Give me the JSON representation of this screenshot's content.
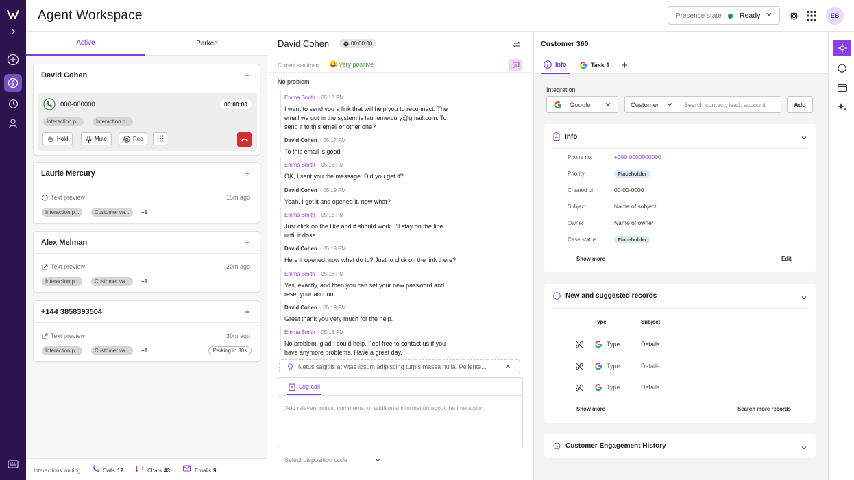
{
  "app": {
    "title": "Agent Workspace"
  },
  "header": {
    "presence_label": "Presence state",
    "presence_value": "Ready",
    "presence_color": "#1f8f3b",
    "avatar_initials": "ES"
  },
  "left_panel": {
    "tabs": [
      "Active",
      "Parked"
    ],
    "active_card": {
      "name": "David Cohen",
      "number": "000-000000",
      "timer": "00:00:00",
      "chips": [
        "Interaction p...",
        "Interaction p..."
      ],
      "buttons": {
        "hold": "Hold",
        "mute": "Mute",
        "rec": "Rec"
      }
    },
    "cards": [
      {
        "name": "Laurie Mercury",
        "preview": "Text preview",
        "age": "15m ago",
        "chips": [
          "Interaction p...",
          "Customer va..."
        ],
        "more": "+1",
        "channel": "whatsapp"
      },
      {
        "name": "Alex Melman",
        "preview": "Text preview",
        "age": "20m ago",
        "chips": [
          "Interaction p...",
          "Customer va..."
        ],
        "more": "+1",
        "channel": "external"
      },
      {
        "name": "+144 3858393504",
        "preview": "Text preview",
        "age": "30m ago",
        "chips": [
          "Interaction p...",
          "Customer va..."
        ],
        "more": "+1",
        "parking": "Parking in 30s",
        "channel": "external"
      }
    ],
    "footer": {
      "waiting_label": "Interactions waiting",
      "calls_label": "Calls",
      "calls_count": "12",
      "chats_label": "Chats",
      "chats_count": "43",
      "emails_label": "Emails",
      "emails_count": "9"
    }
  },
  "conversation": {
    "name": "David Cohen",
    "timer": "00:00:00",
    "sentiment_label": "Current sentiment",
    "sentiment_value": "Very positive",
    "first_line": "No problem",
    "messages": [
      {
        "who": "Emma Smith",
        "time": "05:18 PM",
        "agent": true,
        "lines": [
          "I want to send you a link that will help you to reconnect. The",
          "email we got in the system is lauriemercury@gmail.com. To",
          "send it to this email or other one?"
        ]
      },
      {
        "who": "David Cohen",
        "time": "05:17 PM",
        "agent": false,
        "lines": [
          "To this email is good"
        ]
      },
      {
        "who": "Emma Smith",
        "time": "05:18 PM",
        "agent": true,
        "lines": [
          "OK, I sent you the message. Did you get it?"
        ]
      },
      {
        "who": "David Cohen",
        "time": "05:19 PM",
        "agent": false,
        "lines": [
          "Yeah, I got it and opened it, now what?"
        ]
      },
      {
        "who": "Emma Smith",
        "time": "05:18 PM",
        "agent": true,
        "lines": [
          "Just click on the like and it should work. I'll stay on the line",
          "until it dose."
        ]
      },
      {
        "who": "David Cohen",
        "time": "05:19 PM",
        "agent": false,
        "lines": [
          "Here it opened. now what do to? Just to click on the link there?"
        ]
      },
      {
        "who": "Emma Smith",
        "time": "05:18 PM",
        "agent": true,
        "lines": [
          "Yes, exactly, and then you can set your new password and",
          "reset your account"
        ]
      },
      {
        "who": "David Cohen",
        "time": "05:19 PM",
        "agent": false,
        "lines": [
          "Great thank you very much for the help."
        ]
      },
      {
        "who": "Emma Smith",
        "time": "05:18 PM",
        "agent": true,
        "lines": [
          "No problem, glad I could help. Feel free to contact us if you",
          "have anymore problems. Have a great day."
        ]
      }
    ],
    "suggestion": "Netus sagittis at vitae ipsum adipiscing turpis massa nulla. Pellente...",
    "log_tab": "Log call",
    "log_placeholder": "Add relevant notes, comments, or additional information about the interaction.",
    "disposition_placeholder": "Select disposition code"
  },
  "customer360": {
    "title": "Customer 360",
    "tabs": [
      "Info",
      "Task 1"
    ],
    "integration_label": "Integration",
    "integration_value": "Google",
    "type_value": "Customer",
    "search_placeholder": "Search contact, lead, account",
    "add_label": "Add",
    "info": {
      "title": "Info",
      "fields": [
        {
          "label": "Phone no.",
          "value": "+000 0000000000",
          "kind": "link"
        },
        {
          "label": "Priority",
          "value": "Placeholder",
          "kind": "pill-blue"
        },
        {
          "label": "Created on",
          "value": "00-00-0000",
          "kind": "text"
        },
        {
          "label": "Subject",
          "value": "Name of subject",
          "kind": "text"
        },
        {
          "label": "Owner",
          "value": "Name of owner",
          "kind": "text"
        },
        {
          "label": "Case status",
          "value": "Placeholder",
          "kind": "pill-green"
        }
      ],
      "show_more": "Show more",
      "edit": "Edit"
    },
    "records": {
      "title": "New and suggested records",
      "col_type": "Type",
      "col_subject": "Subject",
      "rows": [
        {
          "type": "Type",
          "subject": "Details"
        },
        {
          "type": "Type",
          "subject": "Details"
        },
        {
          "type": "Type",
          "subject": "Details"
        }
      ],
      "show_more": "Show more",
      "search_more": "Search more records"
    },
    "history_title": "Customer Engagement History"
  },
  "colors": {
    "accent": "#7c3fd6",
    "rail": "#2c1450",
    "end_call": "#d32f2f"
  }
}
